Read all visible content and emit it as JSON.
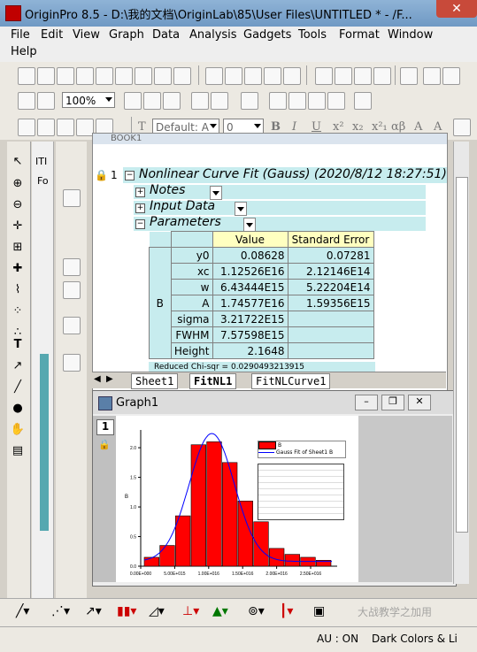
{
  "window": {
    "title": "OriginPro 8.5 - D:\\我的文档\\OriginLab\\85\\User Files\\UNTITLED * - /F..."
  },
  "menu": {
    "items": [
      "File",
      "Edit",
      "View",
      "Graph",
      "Data",
      "Analysis",
      "Gadgets",
      "Tools",
      "Format",
      "Window",
      "Help"
    ]
  },
  "toolbar": {
    "zoom": "100%",
    "font": "Default: A",
    "font_size": "0"
  },
  "left_panel": {
    "tab1": "ITI",
    "tab2": "Fo"
  },
  "book": {
    "title": "BOOK1",
    "row_number": "1",
    "report_title": "Nonlinear Curve Fit (Gauss) (2020/8/12 18:27:51)",
    "sections": [
      "Notes",
      "Input Data",
      "Parameters"
    ],
    "param_headers": [
      "Value",
      "Standard Error"
    ],
    "group_label": "B",
    "params": [
      {
        "name": "y0",
        "value": "0.08628",
        "error": "0.07281"
      },
      {
        "name": "xc",
        "value": "1.12526E16",
        "error": "2.12146E14"
      },
      {
        "name": "w",
        "value": "6.43444E15",
        "error": "5.22204E14"
      },
      {
        "name": "A",
        "value": "1.74577E16",
        "error": "1.59356E15"
      },
      {
        "name": "sigma",
        "value": "3.21722E15",
        "error": ""
      },
      {
        "name": "FWHM",
        "value": "7.57598E15",
        "error": ""
      },
      {
        "name": "Height",
        "value": "2.1648",
        "error": ""
      }
    ],
    "footer": "Reduced Chi-sqr = 0.0290493213915",
    "tabs": [
      "Sheet1",
      "FitNL1",
      "FitNLCurve1"
    ]
  },
  "graph": {
    "title": "Graph1",
    "layer": "1",
    "legend": [
      "B",
      "Gauss Fit of Sheet1 B"
    ]
  },
  "chart_data": {
    "type": "bar",
    "categories": [
      "0.00E+000",
      "5.00E+015",
      "1.00E+016",
      "1.50E+016",
      "2.00E+016",
      "2.50E+016"
    ],
    "bars": [
      0.15,
      0.35,
      0.85,
      2.05,
      2.1,
      1.75,
      1.1,
      0.75,
      0.3,
      0.2,
      0.15,
      0.1
    ],
    "yticks": [
      "0.0",
      "0.5",
      "1.0",
      "1.5",
      "2.0"
    ],
    "ylim": [
      0,
      2.3
    ],
    "ylabel": "B",
    "series": [
      {
        "name": "B",
        "color": "#ff0000"
      },
      {
        "name": "Gauss Fit of Sheet1 B",
        "color": "#0000ff"
      }
    ]
  },
  "status": {
    "mode": "AU : ON",
    "theme": "Dark Colors & Li"
  },
  "watermark": "大战教学之加用"
}
